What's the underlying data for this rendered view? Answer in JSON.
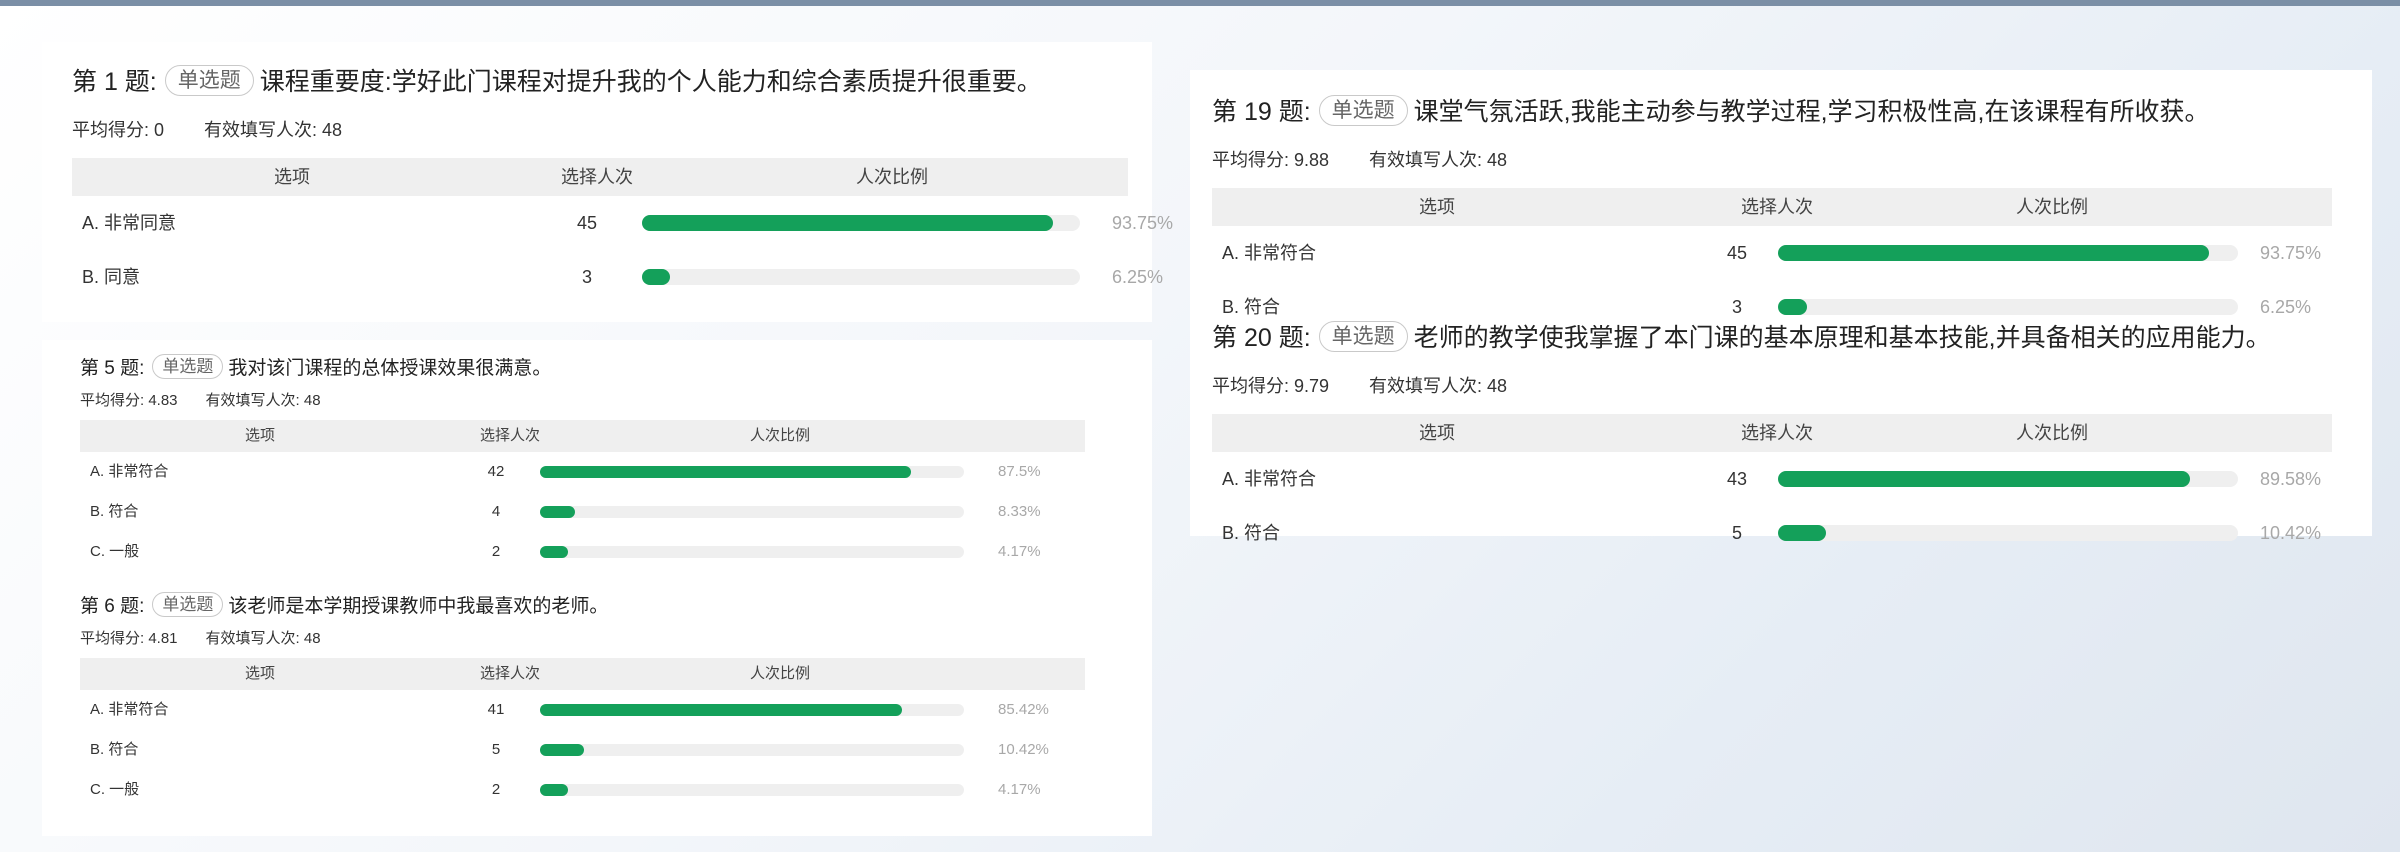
{
  "questions": [
    {
      "id": "q1",
      "number": "第 1 题:",
      "type": "单选题",
      "text": "课程重要度:学好此门课程对提升我的个人能力和综合素质提升很重要。",
      "avg_score": "平均得分: 0",
      "valid_count": "有效填写人次: 48",
      "headers": [
        "选项",
        "选择人次",
        "人次比例"
      ],
      "rows": [
        {
          "option": "A. 非常同意",
          "count": "45",
          "percent": "93.75%",
          "ratio": 0.9375
        },
        {
          "option": "B. 同意",
          "count": "3",
          "percent": "6.25%",
          "ratio": 0.0625
        }
      ]
    },
    {
      "id": "q5",
      "number": "第 5 题:",
      "type": "单选题",
      "text": "我对该门课程的总体授课效果很满意。",
      "avg_score": "平均得分: 4.83",
      "valid_count": "有效填写人次: 48",
      "headers": [
        "选项",
        "选择人次",
        "人次比例"
      ],
      "rows": [
        {
          "option": "A. 非常符合",
          "count": "42",
          "percent": "87.5%",
          "ratio": 0.875
        },
        {
          "option": "B. 符合",
          "count": "4",
          "percent": "8.33%",
          "ratio": 0.0833
        },
        {
          "option": "C. 一般",
          "count": "2",
          "percent": "4.17%",
          "ratio": 0.0417
        }
      ]
    },
    {
      "id": "q6",
      "number": "第 6 题:",
      "type": "单选题",
      "text": "该老师是本学期授课教师中我最喜欢的老师。",
      "avg_score": "平均得分: 4.81",
      "valid_count": "有效填写人次: 48",
      "headers": [
        "选项",
        "选择人次",
        "人次比例"
      ],
      "rows": [
        {
          "option": "A. 非常符合",
          "count": "41",
          "percent": "85.42%",
          "ratio": 0.8542
        },
        {
          "option": "B. 符合",
          "count": "5",
          "percent": "10.42%",
          "ratio": 0.1042
        },
        {
          "option": "C. 一般",
          "count": "2",
          "percent": "4.17%",
          "ratio": 0.0417
        }
      ]
    },
    {
      "id": "q19",
      "number": "第 19 题:",
      "type": "单选题",
      "text": "课堂气氛活跃,我能主动参与教学过程,学习积极性高,在该课程有所收获。",
      "avg_score": "平均得分: 9.88",
      "valid_count": "有效填写人次: 48",
      "headers": [
        "选项",
        "选择人次",
        "人次比例"
      ],
      "rows": [
        {
          "option": "A. 非常符合",
          "count": "45",
          "percent": "93.75%",
          "ratio": 0.9375
        },
        {
          "option": "B. 符合",
          "count": "3",
          "percent": "6.25%",
          "ratio": 0.0625
        }
      ]
    },
    {
      "id": "q20",
      "number": "第 20 题:",
      "type": "单选题",
      "text": "老师的教学使我掌握了本门课的基本原理和基本技能,并具备相关的应用能力。",
      "avg_score": "平均得分: 9.79",
      "valid_count": "有效填写人次: 48",
      "headers": [
        "选项",
        "选择人次",
        "人次比例"
      ],
      "rows": [
        {
          "option": "A. 非常符合",
          "count": "43",
          "percent": "89.58%",
          "ratio": 0.8958
        },
        {
          "option": "B. 符合",
          "count": "5",
          "percent": "10.42%",
          "ratio": 0.1042
        }
      ]
    }
  ],
  "colors": {
    "bar_fill": "#14a05a",
    "bar_track": "#efefef",
    "header_bg": "#efefef",
    "percent_text": "#a8a8a8"
  }
}
